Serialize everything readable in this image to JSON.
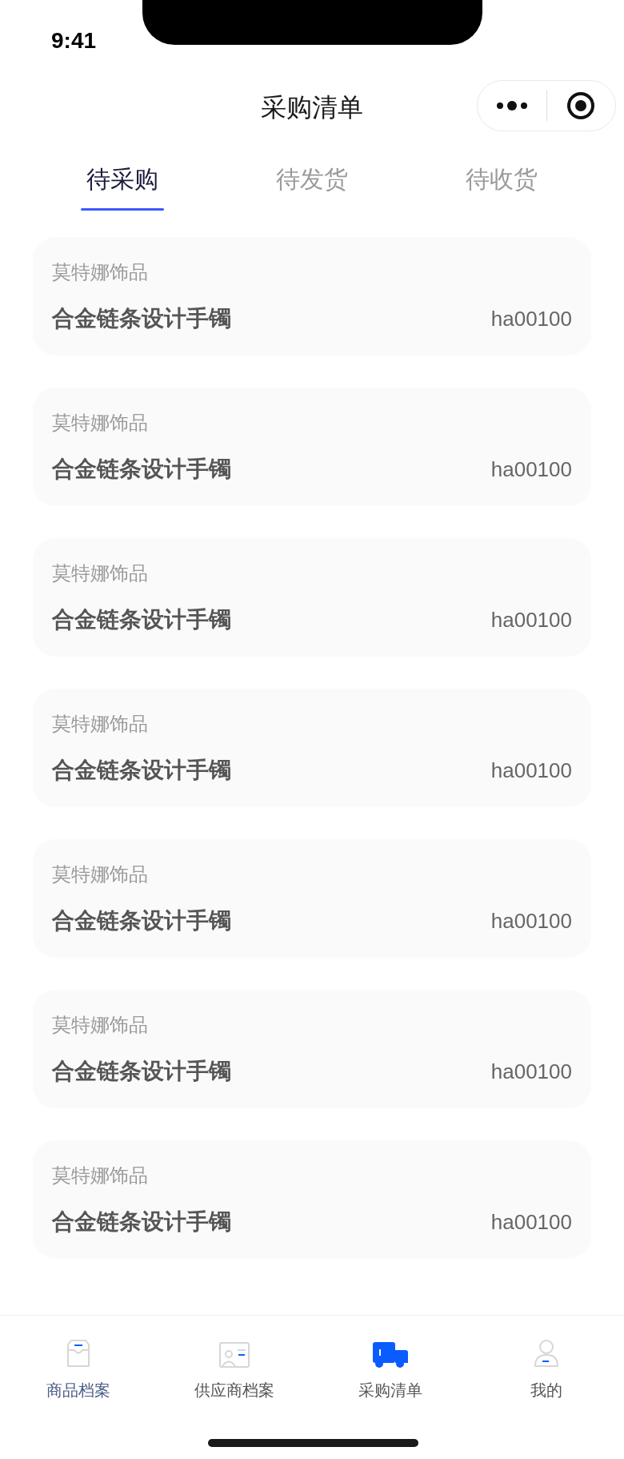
{
  "status_bar": {
    "time": "9:41"
  },
  "header": {
    "title": "采购清单"
  },
  "tabs": [
    {
      "label": "待采购",
      "selected": true
    },
    {
      "label": "待发货",
      "selected": false
    },
    {
      "label": "待收货",
      "selected": false
    }
  ],
  "orders": [
    {
      "supplier": "莫特娜饰品",
      "product": "合金链条设计手镯",
      "code": "ha00100"
    },
    {
      "supplier": "莫特娜饰品",
      "product": "合金链条设计手镯",
      "code": "ha00100"
    },
    {
      "supplier": "莫特娜饰品",
      "product": "合金链条设计手镯",
      "code": "ha00100"
    },
    {
      "supplier": "莫特娜饰品",
      "product": "合金链条设计手镯",
      "code": "ha00100"
    },
    {
      "supplier": "莫特娜饰品",
      "product": "合金链条设计手镯",
      "code": "ha00100"
    },
    {
      "supplier": "莫特娜饰品",
      "product": "合金链条设计手镯",
      "code": "ha00100"
    },
    {
      "supplier": "莫特娜饰品",
      "product": "合金链条设计手镯",
      "code": "ha00100"
    }
  ],
  "bottom_nav": [
    {
      "label": "商品档案",
      "kind": "box",
      "selected": false,
      "label_highlighted": true
    },
    {
      "label": "供应商档案",
      "kind": "card",
      "selected": false,
      "label_highlighted": false
    },
    {
      "label": "采购清单",
      "kind": "truck",
      "selected": true,
      "label_highlighted": false
    },
    {
      "label": "我的",
      "kind": "person",
      "selected": false,
      "label_highlighted": false
    }
  ]
}
